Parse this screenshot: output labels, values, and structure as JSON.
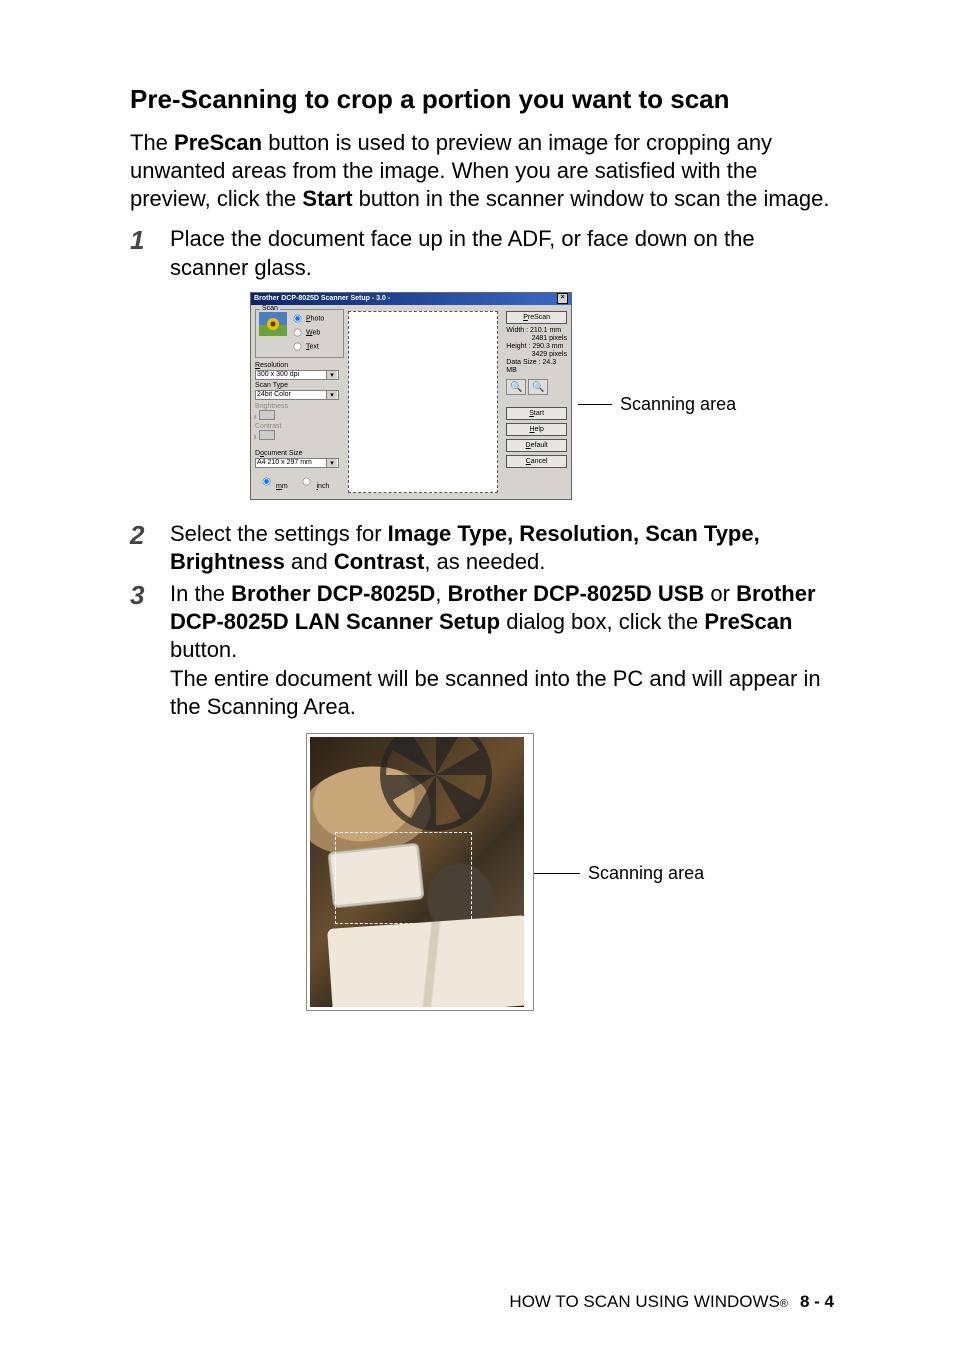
{
  "heading": "Pre-Scanning to crop a portion you want to scan",
  "intro": {
    "pre1": "The ",
    "b1": "PreScan",
    "post1": " button is used to preview an image for cropping any unwanted areas from the image. When you are satisfied with the preview, click the ",
    "b2": "Start",
    "post2": " button in the scanner window to scan the image."
  },
  "step1": {
    "num": "1",
    "text": "Place the document face up in the ADF, or face down on the scanner glass."
  },
  "step2": {
    "num": "2",
    "pre": "Select the settings for ",
    "b1": "Image Type, Resolution, Scan Type, Brightness",
    "mid": " and ",
    "b2": "Contrast",
    "post": ", as needed."
  },
  "step3": {
    "num": "3",
    "t1": "In the ",
    "b1": "Brother DCP-8025D",
    "t2": ", ",
    "b2": "Brother DCP-8025D USB",
    "t3": " or ",
    "b3": "Brother DCP-8025D LAN Scanner Setup",
    "t4": " dialog box, click the ",
    "b4": "PreScan",
    "t5": " button.",
    "line2": "The entire document will be scanned into the PC and will appear in the Scanning Area."
  },
  "dialog": {
    "title": "Brother DCP-8025D Scanner Setup - 3.0 -",
    "close": "×",
    "group_scan": "Scan",
    "radio_photo": "Photo",
    "radio_web": "Web",
    "radio_text": "Text",
    "lbl_resolution": "Resolution",
    "val_resolution": "300 x 300 dpi",
    "lbl_scantype": "Scan Type",
    "val_scantype": "24bit Color",
    "lbl_brightness": "Brightness",
    "lbl_contrast": "Contrast",
    "lbl_docsize": "Document Size",
    "val_docsize": "A4 210 x 297 mm",
    "unit_mm": "mm",
    "unit_inch": "inch",
    "btn_prescan": "PreScan",
    "info_w": "Width :  210.1 mm",
    "info_w2": "2481 pixels",
    "info_h": "Height :  290.3 mm",
    "info_h2": "3429 pixels",
    "info_d": "Data Size :   24.3 MB",
    "btn_start": "Start",
    "btn_help": "Help",
    "btn_default": "Default",
    "btn_cancel": "Cancel"
  },
  "callout_scanning": "Scanning area",
  "footer": {
    "text": "HOW TO SCAN USING WINDOWS",
    "reg": "®",
    "page": "8 - 4"
  }
}
